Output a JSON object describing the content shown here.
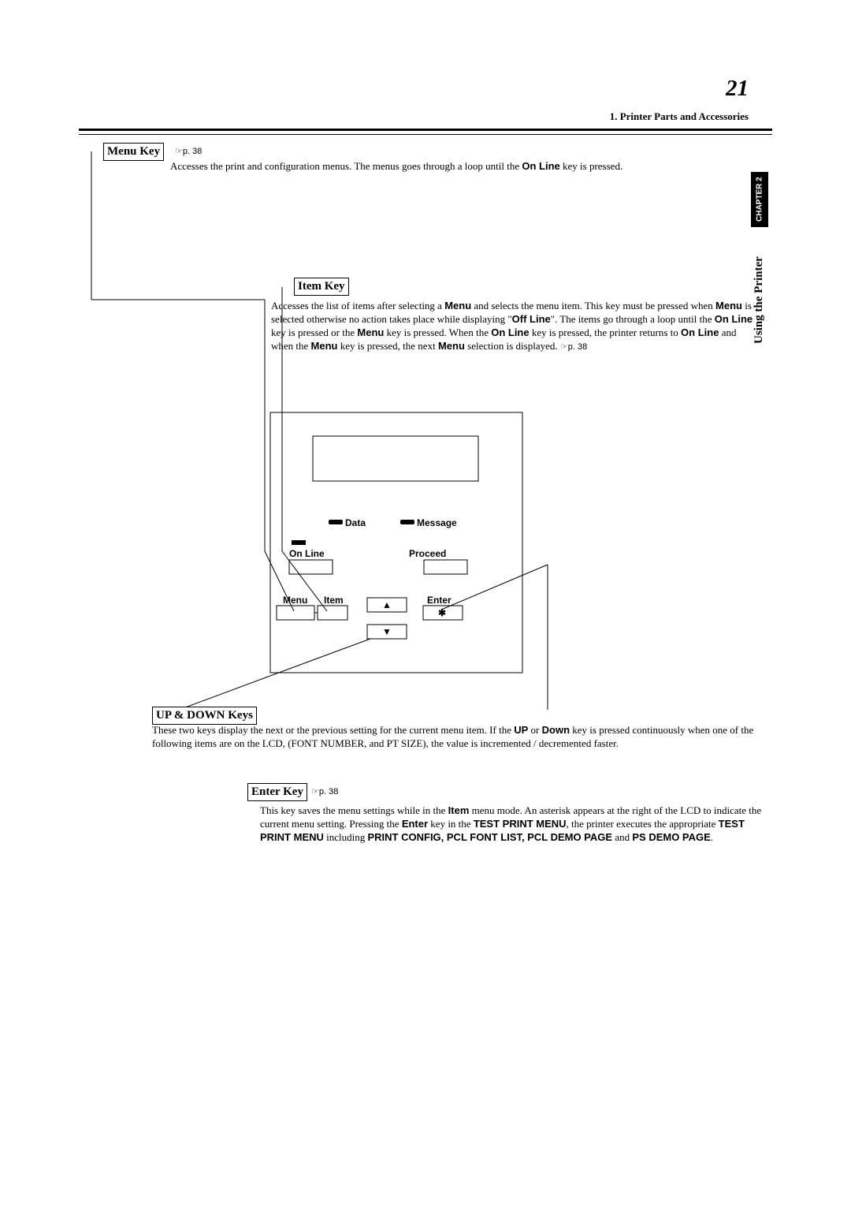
{
  "page_number": "21",
  "header": {
    "section": "1. Printer Parts and Accessories"
  },
  "side_tab": "CHAPTER 2",
  "side_label": "Using the Printer",
  "menu_key": {
    "title": "Menu Key",
    "pageref": "☞p. 38",
    "text_1": "Accesses the print and configuration menus. The menus goes through a loop until the ",
    "on_line": "On Line",
    "text_2": " key is pressed."
  },
  "item_key": {
    "title": "Item Key",
    "text_1": "Accesses the list of items after selecting a ",
    "menu": "Menu",
    "text_2": " and selects the menu item. This key must be pressed when ",
    "text_3": " is selected otherwise no action takes place while displaying \"",
    "off_line": "Off Line",
    "text_4": "\". The items go through a loop until the ",
    "on_line": "On Line",
    "text_5": " key is pressed or the ",
    "text_6": " key is pressed. When the ",
    "text_7": " key is pressed, the printer returns to ",
    "text_8": " and when the ",
    "text_9": " key is pressed, the next ",
    "text_10": " selection is displayed. ",
    "pageref": "☞p. 38"
  },
  "updown_keys": {
    "title": "UP & DOWN Keys",
    "text_1": "These two keys display the next or the previous setting for the current menu item. If the ",
    "up": "UP",
    "text_2": " or ",
    "down": "Down",
    "text_3": " key is pressed continuously when one of the following items are on the LCD, (FONT NUMBER, and PT SIZE), the value is incremented / decremented faster."
  },
  "enter_key": {
    "title": "Enter Key",
    "pageref": "☞p. 38",
    "text_1": "This key saves the menu settings while in the ",
    "item": "Item",
    "text_2": " menu mode. An asterisk appears at the right of the LCD to indicate the current menu setting. Pressing the ",
    "enter": "Enter",
    "text_3": " key in the ",
    "tpm": "TEST PRINT MENU",
    "text_4": ", the printer executes the appropriate ",
    "text_5": " including ",
    "items": "PRINT CONFIG, PCL FONT LIST, PCL DEMO PAGE",
    "text_6": " and ",
    "ps": "PS DEMO PAGE",
    "text_7": "."
  },
  "panel": {
    "data": "Data",
    "message": "Message",
    "online": "On Line",
    "proceed": "Proceed",
    "menu": "Menu",
    "item": "Item",
    "enter": "Enter",
    "up": "▲",
    "down": "▼",
    "star": "✱"
  }
}
